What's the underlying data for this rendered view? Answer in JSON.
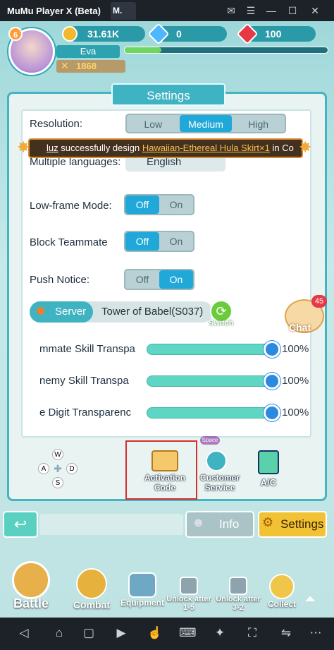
{
  "window": {
    "title": "MuMu Player X  (Beta)",
    "tab": "M.",
    "controls": [
      "mail-icon",
      "menu-icon",
      "minimize-icon",
      "maximize-icon",
      "close-icon"
    ]
  },
  "player": {
    "level": "6",
    "name": "Eva",
    "power": "1868",
    "exp_fraction": 0.18
  },
  "resources": {
    "gold": "31.61K",
    "gems": "0",
    "rubies": "100"
  },
  "settings": {
    "title": "Settings",
    "resolution": {
      "label": "Resolution:",
      "options": [
        "Low",
        "Medium",
        "High"
      ],
      "selected": "Medium"
    },
    "language": {
      "label": "Multiple languages:",
      "value": "English"
    },
    "low_frame": {
      "label": "Low-frame Mode:",
      "off": "Off",
      "on": "On",
      "selected": "Off"
    },
    "block_teammate": {
      "label": "Block Teammate",
      "off": "Off",
      "on": "On",
      "selected": "Off"
    },
    "push_notice": {
      "label": "Push Notice:",
      "off": "Off",
      "on": "On",
      "selected": "On"
    },
    "server": {
      "label": "Server",
      "value": "Tower of Babel(S037)",
      "switch": "Switch"
    },
    "sliders": [
      {
        "label": "mmate Skill Transpa",
        "value": "100%",
        "level": 1.0
      },
      {
        "label": "nemy Skill Transpa",
        "value": "100%",
        "level": 1.0
      },
      {
        "label": "e Digit Transparenc",
        "value": "100%",
        "level": 1.0
      }
    ]
  },
  "banner": {
    "user": "luz",
    "text": " successfully design ",
    "item": "Hawaiian-Ethereal Hula Skirt×1",
    "suffix": " in Co"
  },
  "chat": {
    "label": "Chat",
    "badge": "45"
  },
  "actions": {
    "space_hint": "Space",
    "activation": "Activation Code",
    "customer": "Customer Service",
    "ac": "A/C"
  },
  "wasd": [
    "W",
    "A",
    "S",
    "D"
  ],
  "buttons": {
    "info": "Info",
    "settings": "Settings"
  },
  "nav": [
    {
      "label": "Battle"
    },
    {
      "label": "Combat"
    },
    {
      "label": "Equipment"
    },
    {
      "label": "Unlock after 1-5"
    },
    {
      "label": "Unlock after 3-2"
    },
    {
      "label": "Collect"
    }
  ],
  "colors": {
    "accent": "#20a8d8",
    "panel_border": "#43b4c0",
    "highlight_box": "#d32f2f"
  }
}
